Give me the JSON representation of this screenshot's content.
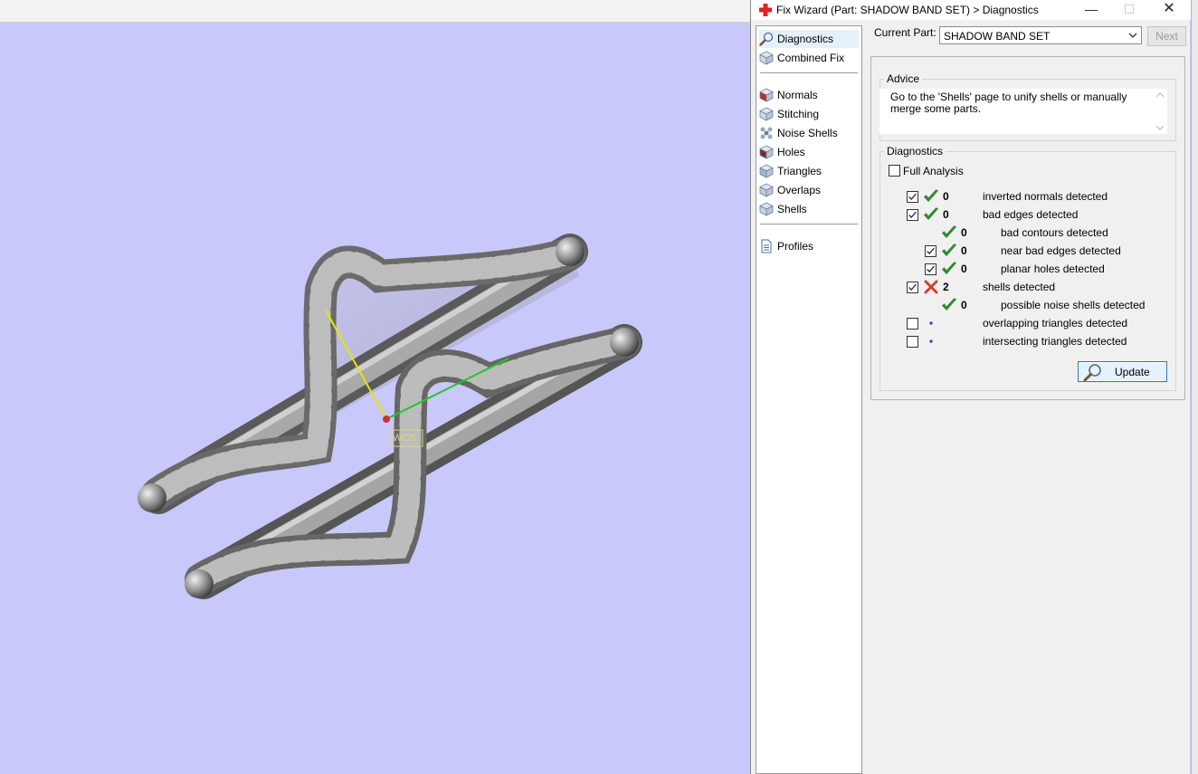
{
  "window": {
    "title": "Fix Wizard (Part: SHADOW BAND SET) > Diagnostics",
    "icon": "red-cross-icon",
    "controls": [
      "minimize-icon",
      "maximize-icon",
      "close-icon"
    ]
  },
  "viewport": {
    "background": "#c8c8fb",
    "axis_label": "WCS"
  },
  "nav": {
    "groups": [
      [
        {
          "label": "Diagnostics",
          "icon": "magnifier-icon",
          "selected": true
        },
        {
          "label": "Combined Fix",
          "icon": "cube-icon"
        }
      ],
      [
        {
          "label": "Normals",
          "icon": "normals-cube-icon"
        },
        {
          "label": "Stitching",
          "icon": "stitching-cube-icon"
        },
        {
          "label": "Noise Shells",
          "icon": "noise-shells-icon"
        },
        {
          "label": "Holes",
          "icon": "holes-cube-icon"
        },
        {
          "label": "Triangles",
          "icon": "triangles-cube-icon"
        },
        {
          "label": "Overlaps",
          "icon": "overlaps-cube-icon"
        },
        {
          "label": "Shells",
          "icon": "shells-cube-icon"
        }
      ],
      [
        {
          "label": "Profiles",
          "icon": "document-icon"
        }
      ]
    ]
  },
  "current_part": {
    "label": "Current Part:",
    "value": "SHADOW BAND SET"
  },
  "next_button": "Next",
  "advice": {
    "legend": "Advice",
    "text": "Go to the 'Shells' page to unify shells or manually merge some parts."
  },
  "diagnostics": {
    "legend": "Diagnostics",
    "full_analysis": {
      "label": "Full Analysis",
      "checked": false
    },
    "rows": [
      {
        "checkbox": true,
        "checked": true,
        "status": "ok",
        "value": "0",
        "label": "inverted normals detected",
        "indent": 0
      },
      {
        "checkbox": true,
        "checked": true,
        "status": "ok",
        "value": "0",
        "label": "bad edges detected",
        "indent": 0
      },
      {
        "checkbox": false,
        "checked": false,
        "status": "ok",
        "value": "0",
        "label": "bad contours detected",
        "indent": 1
      },
      {
        "checkbox": true,
        "checked": true,
        "status": "ok",
        "value": "0",
        "label": "near bad edges detected",
        "indent": 1
      },
      {
        "checkbox": true,
        "checked": true,
        "status": "ok",
        "value": "0",
        "label": "planar holes detected",
        "indent": 1
      },
      {
        "checkbox": true,
        "checked": true,
        "status": "fail",
        "value": "2",
        "label": "shells detected",
        "indent": 0
      },
      {
        "checkbox": false,
        "checked": false,
        "status": "ok",
        "value": "0",
        "label": "possible noise shells detected",
        "indent": 1
      },
      {
        "checkbox": true,
        "checked": false,
        "status": "none",
        "value": "",
        "label": "overlapping triangles detected",
        "indent": 0
      },
      {
        "checkbox": true,
        "checked": false,
        "status": "none",
        "value": "",
        "label": "intersecting triangles detected",
        "indent": 0
      }
    ]
  },
  "update_button": "Update",
  "colors": {
    "ok": "#2f8a2f",
    "fail": "#d2402a",
    "accent": "#2c76c4"
  }
}
